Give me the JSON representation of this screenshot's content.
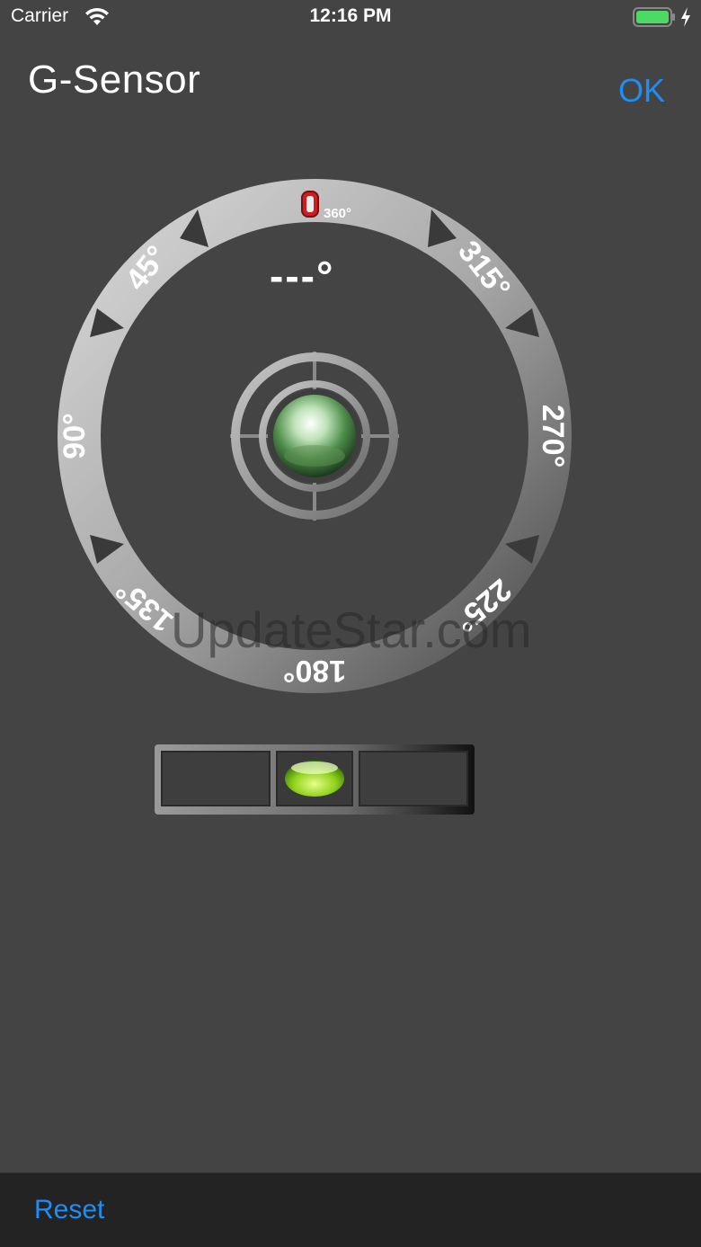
{
  "status_bar": {
    "carrier": "Carrier",
    "time": "12:16 PM",
    "battery_color": "#4cd964"
  },
  "nav": {
    "title": "G-Sensor",
    "ok_label": "OK"
  },
  "dial": {
    "readout": "---°",
    "top_label": "360°",
    "labels": {
      "deg45": "45°",
      "deg90": "90°",
      "deg135": "135°",
      "deg180": "180°",
      "deg225": "225°",
      "deg270": "270°",
      "deg315": "315°"
    },
    "top_marker_color": "#cc1f1f"
  },
  "watermark": "UpdateStar.com",
  "toolbar": {
    "reset_label": "Reset"
  },
  "colors": {
    "background": "#444444",
    "accent": "#1e8ef5",
    "toolbar": "#232323"
  }
}
